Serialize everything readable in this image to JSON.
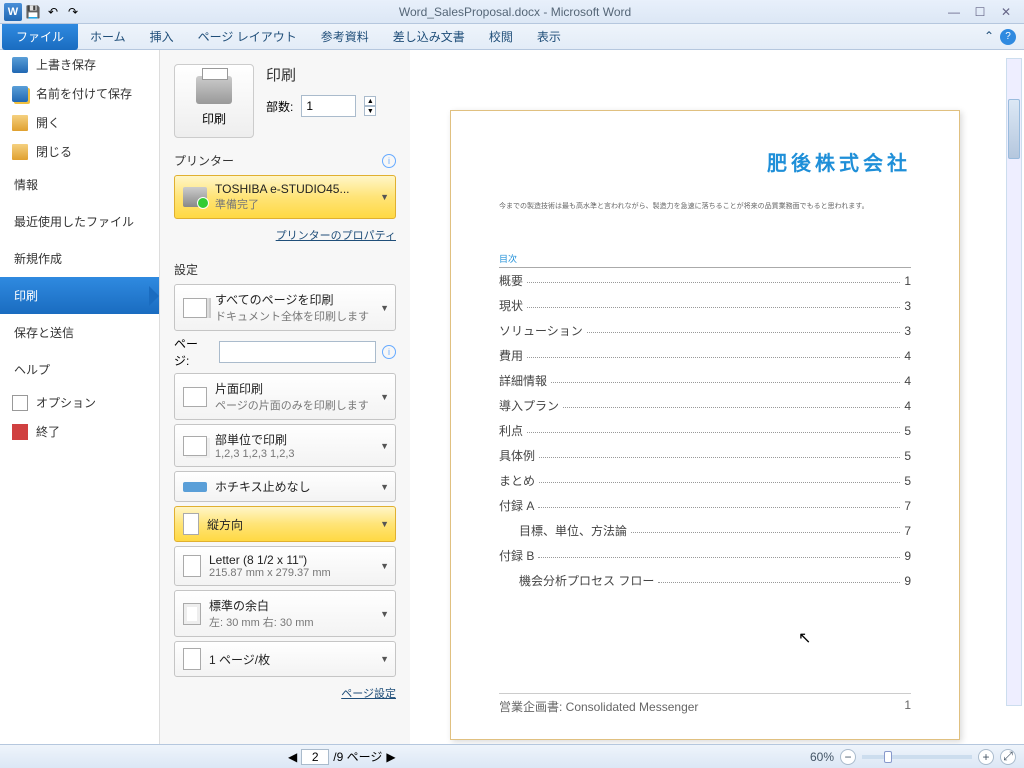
{
  "window": {
    "title": "Word_SalesProposal.docx - Microsoft Word"
  },
  "ribbon": {
    "file": "ファイル",
    "tabs": [
      "ホーム",
      "挿入",
      "ページ レイアウト",
      "参考資料",
      "差し込み文書",
      "校閲",
      "表示"
    ]
  },
  "sidebar": {
    "save": "上書き保存",
    "saveas": "名前を付けて保存",
    "open": "開く",
    "close": "閉じる",
    "info": "情報",
    "recent": "最近使用したファイル",
    "new": "新規作成",
    "print": "印刷",
    "share": "保存と送信",
    "help": "ヘルプ",
    "options": "オプション",
    "exit": "終了"
  },
  "print": {
    "heading": "印刷",
    "button": "印刷",
    "copies_label": "部数:",
    "copies": "1",
    "printer_heading": "プリンター",
    "printer_name": "TOSHIBA e-STUDIO45...",
    "printer_status": "準備完了",
    "printer_props": "プリンターのプロパティ",
    "settings_heading": "設定",
    "allpages": "すべてのページを印刷",
    "allpages_sub": "ドキュメント全体を印刷します",
    "pages_label": "ページ:",
    "oneside": "片面印刷",
    "oneside_sub": "ページの片面のみを印刷します",
    "collate": "部単位で印刷",
    "collate_sub": "1,2,3    1,2,3    1,2,3",
    "staple": "ホチキス止めなし",
    "orient": "縦方向",
    "paper": "Letter (8 1/2 x 11\")",
    "paper_sub": "215.87 mm x 279.37 mm",
    "margins": "標準の余白",
    "margins_sub": "左: 30 mm   右: 30 mm",
    "perpage": "1 ページ/枚",
    "pagesetup": "ページ設定"
  },
  "preview": {
    "company": "肥後株式会社",
    "intro": "今までの製造技術は最も高水準と言われながら、製造力を急速に落ちることが将来の品質業務面でもると思われます。",
    "toc_heading": "目次",
    "toc": [
      {
        "t": "概要",
        "p": "1"
      },
      {
        "t": "現状",
        "p": "3"
      },
      {
        "t": "ソリューション",
        "p": "3"
      },
      {
        "t": "費用",
        "p": "4"
      },
      {
        "t": "詳細情報",
        "p": "4"
      },
      {
        "t": "導入プラン",
        "p": "4"
      },
      {
        "t": "利点",
        "p": "5"
      },
      {
        "t": "具体例",
        "p": "5"
      },
      {
        "t": "まとめ",
        "p": "5"
      },
      {
        "t": "付録 A",
        "p": "7"
      },
      {
        "t": "目標、単位、方法論",
        "p": "7",
        "sub": true
      },
      {
        "t": "付録 B",
        "p": "9"
      },
      {
        "t": "機会分析プロセス フロー",
        "p": "9",
        "sub": true
      }
    ],
    "footer_left": "営業企画書: Consolidated Messenger",
    "footer_right": "1"
  },
  "status": {
    "page": "2",
    "total": "/9 ページ",
    "zoom": "60%"
  }
}
